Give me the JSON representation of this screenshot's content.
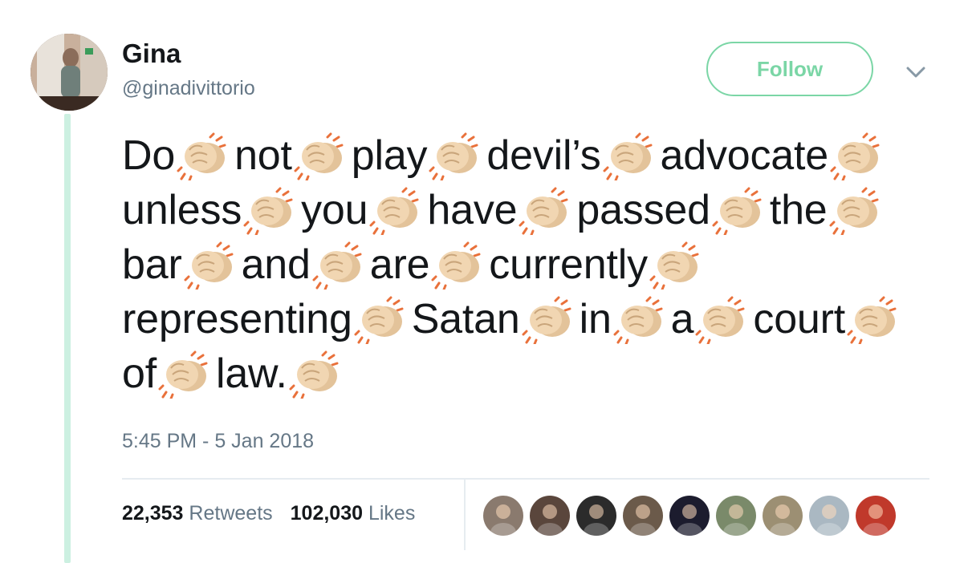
{
  "tweet": {
    "author_name": "Gina",
    "author_handle": "@ginadivittorio",
    "follow_label": "Follow",
    "words": [
      "Do",
      "not",
      "play",
      "devil’s",
      "advocate",
      "unless",
      "you",
      "have",
      "passed",
      "the",
      "bar",
      "and",
      "are",
      "currently",
      "representing",
      "Satan",
      "in",
      "a",
      "court",
      "of",
      "law."
    ],
    "emoji_icon": "clapping-hands-icon",
    "timestamp": "5:45 PM - 5 Jan 2018",
    "retweets_count": "22,353",
    "retweets_label": "Retweets",
    "likes_count": "102,030",
    "likes_label": "Likes"
  },
  "likers": [
    {
      "icon": "liker-avatar-1",
      "color": "#8a7a6e"
    },
    {
      "icon": "liker-avatar-2",
      "color": "#5a463c"
    },
    {
      "icon": "liker-avatar-3",
      "color": "#2b2b2b"
    },
    {
      "icon": "liker-avatar-4",
      "color": "#6b5a4a"
    },
    {
      "icon": "liker-avatar-5",
      "color": "#1c1c2e"
    },
    {
      "icon": "liker-avatar-6",
      "color": "#7a8a6a"
    },
    {
      "icon": "liker-avatar-7",
      "color": "#9c8f73"
    },
    {
      "icon": "liker-avatar-8",
      "color": "#aab8c2"
    },
    {
      "icon": "liker-avatar-9",
      "color": "#c0392b"
    }
  ],
  "colors": {
    "accent_green": "#7bd6a6",
    "thread_line": "#ccf0e1",
    "text": "#14171a",
    "secondary_text": "#657786"
  }
}
